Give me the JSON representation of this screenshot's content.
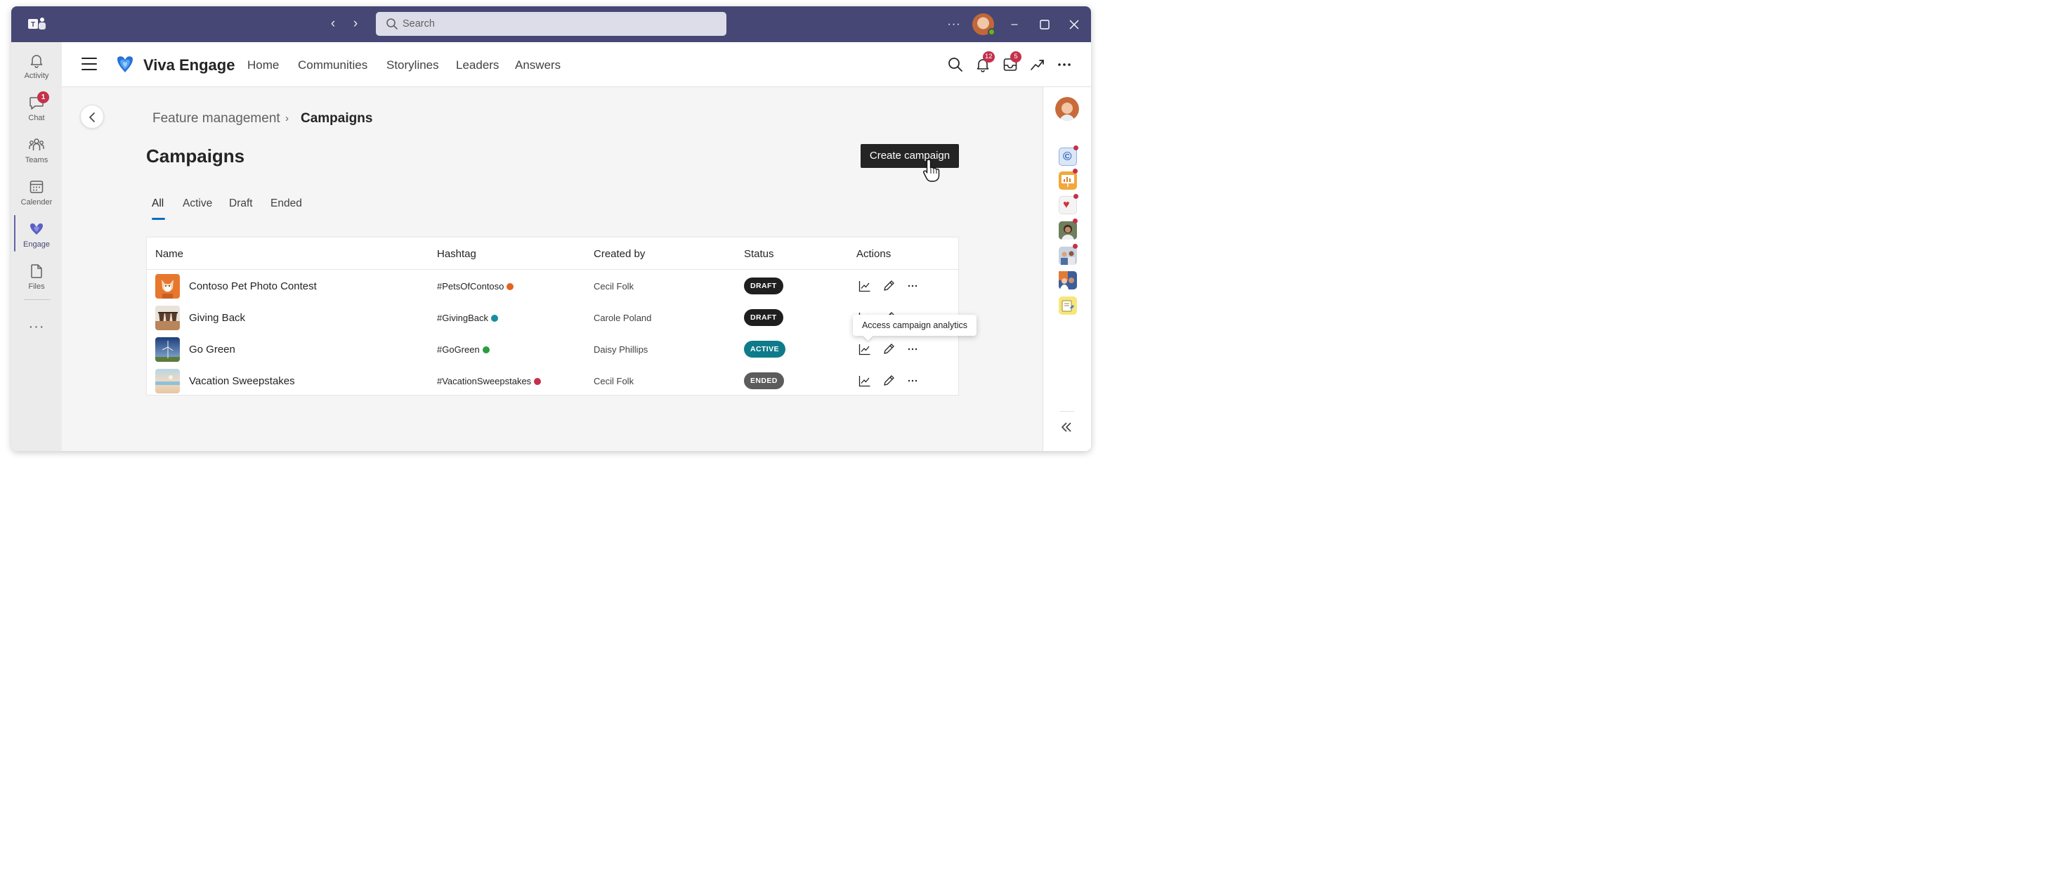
{
  "titlebar": {
    "search_placeholder": "Search",
    "more_label": "···"
  },
  "rail": {
    "items": [
      {
        "label": "Activity",
        "icon": "bell-icon"
      },
      {
        "label": "Chat",
        "icon": "chat-icon",
        "badge": "1"
      },
      {
        "label": "Teams",
        "icon": "teams-icon"
      },
      {
        "label": "Calender",
        "icon": "calendar-icon"
      },
      {
        "label": "Engage",
        "icon": "engage-icon",
        "active": true
      },
      {
        "label": "Files",
        "icon": "file-icon"
      }
    ],
    "more_label": "···"
  },
  "header": {
    "app_title": "Viva Engage",
    "nav": [
      "Home",
      "Communities",
      "Storylines",
      "Leaders",
      "Answers"
    ],
    "notifications_badge": "12",
    "inbox_badge": "5"
  },
  "main": {
    "breadcrumb": [
      "Feature management",
      "Campaigns"
    ],
    "page_title": "Campaigns",
    "create_label": "Create campaign",
    "tabs": [
      "All",
      "Active",
      "Draft",
      "Ended"
    ],
    "active_tab": "All",
    "table": {
      "headers": [
        "Name",
        "Hashtag",
        "Created by",
        "Status",
        "Actions"
      ],
      "rows": [
        {
          "name": "Contoso Pet Photo Contest",
          "hashtag": "#PetsOfContoso",
          "badge_color": "#e3641e",
          "created_by": "Cecil Folk",
          "status": "DRAFT"
        },
        {
          "name": "Giving Back",
          "hashtag": "#GivingBack",
          "badge_color": "#1a8ca3",
          "created_by": "Carole Poland",
          "status": "DRAFT"
        },
        {
          "name": "Go Green",
          "hashtag": "#GoGreen",
          "badge_color": "#2e9b3e",
          "created_by": "Daisy Phillips",
          "status": "ACTIVE"
        },
        {
          "name": "Vacation Sweepstakes",
          "hashtag": "#VacationSweepstakes",
          "badge_color": "#c4314b",
          "created_by": "Cecil Folk",
          "status": "ENDED"
        }
      ]
    },
    "tooltip": "Access campaign analytics"
  },
  "colors": {
    "titlebar": "#464775",
    "draft": "#1f1f1f",
    "active": "#0f7b8a",
    "ended": "#5c5c5c",
    "accent": "#0f6cbd"
  }
}
